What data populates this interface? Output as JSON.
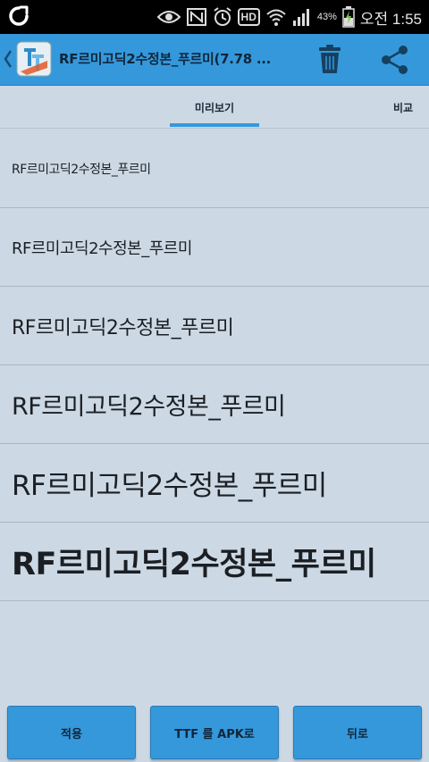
{
  "status_bar": {
    "battery_percent": "43",
    "battery_percent_sign": "%",
    "clock": "오전 1:55",
    "hd_label": "HD"
  },
  "action_bar": {
    "title": "RF르미고딕2수정본_푸르미(7.78 ..."
  },
  "tabs": {
    "preview": "미리보기",
    "compare": "비교"
  },
  "preview_rows": [
    "RF르미고딕2수정본_푸르미",
    "RF르미고딕2수정본_푸르미",
    "RF르미고딕2수정본_푸르미",
    "RF르미고딕2수정본_푸르미",
    "RF르미고딕2수정본_푸르미",
    "RF르미고딕2수정본_푸르미"
  ],
  "buttons": {
    "apply": "적용",
    "ttf_to_apk": "TTF 를 APK로",
    "back": "뒤로"
  },
  "colors": {
    "accent": "#3598db",
    "background": "#ccd9e4",
    "status_bar": "#000000"
  }
}
